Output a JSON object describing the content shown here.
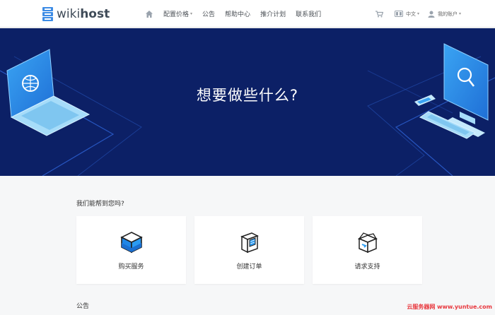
{
  "header": {
    "logo_prefix": "wiki",
    "logo_suffix": "host",
    "nav": [
      {
        "label": "配置价格",
        "has_caret": true
      },
      {
        "label": "公告",
        "has_caret": false
      },
      {
        "label": "帮助中心",
        "has_caret": false
      },
      {
        "label": "推介计划",
        "has_caret": false
      },
      {
        "label": "联系我们",
        "has_caret": false
      }
    ],
    "language_label": "中文",
    "account_label": "我的账户"
  },
  "hero": {
    "title": "想要做些什么?"
  },
  "help": {
    "title": "我们能帮到您吗?",
    "cards": [
      {
        "label": "购买服务",
        "icon": "cube-icon"
      },
      {
        "label": "创建订单",
        "icon": "box-document-icon"
      },
      {
        "label": "请求支持",
        "icon": "open-box-icon"
      }
    ]
  },
  "notice": {
    "title": "公告"
  },
  "watermark": "云服务器网 www.yuntue.com",
  "colors": {
    "hero_bg": "#0c2066",
    "accent": "#2f7ee6"
  }
}
